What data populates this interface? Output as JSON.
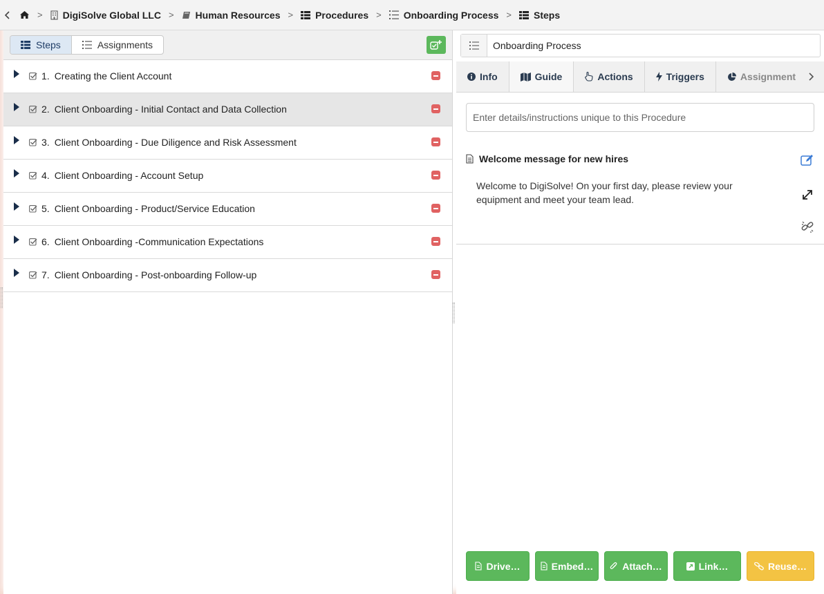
{
  "breadcrumb": {
    "items": [
      {
        "label": "DigiSolve Global LLC",
        "icon": "building-icon"
      },
      {
        "label": "Human Resources",
        "icon": "book-icon"
      },
      {
        "label": "Procedures",
        "icon": "table-list-icon"
      },
      {
        "label": "Onboarding Process",
        "icon": "numbered-list-icon"
      },
      {
        "label": "Steps",
        "icon": "table-list-icon"
      }
    ]
  },
  "left": {
    "tabs": {
      "steps": "Steps",
      "assignments": "Assignments"
    },
    "steps": [
      {
        "num": "1.",
        "label": "Creating the Client Account"
      },
      {
        "num": "2.",
        "label": "Client Onboarding - Initial Contact and Data Collection"
      },
      {
        "num": "3.",
        "label": "Client Onboarding - Due Diligence and Risk Assessment"
      },
      {
        "num": "4.",
        "label": "Client Onboarding - Account Setup"
      },
      {
        "num": "5.",
        "label": "Client Onboarding - Product/Service Education"
      },
      {
        "num": "6.",
        "label": "Client Onboarding -Communication Expectations"
      },
      {
        "num": "7.",
        "label": "Client Onboarding - Post-onboarding Follow-up"
      }
    ]
  },
  "right": {
    "title": "Onboarding Process",
    "tabs": {
      "info": "Info",
      "guide": "Guide",
      "actions": "Actions",
      "triggers": "Triggers",
      "assignments": "Assignment"
    },
    "details_placeholder": "Enter details/instructions unique to this Procedure",
    "message": {
      "title": "Welcome message for new hires",
      "body": "Welcome to DigiSolve! On your first day, please review your equipment and meet your team lead."
    },
    "buttons": {
      "drive": "Drive…",
      "embed": "Embed…",
      "attach": "Attach…",
      "link": "Link…",
      "reuse": "Reuse…"
    }
  },
  "colors": {
    "accent_green": "#5cb85c",
    "accent_yellow": "#f3c343",
    "remove_red": "#e06262",
    "tab_text": "#2a3b50"
  }
}
